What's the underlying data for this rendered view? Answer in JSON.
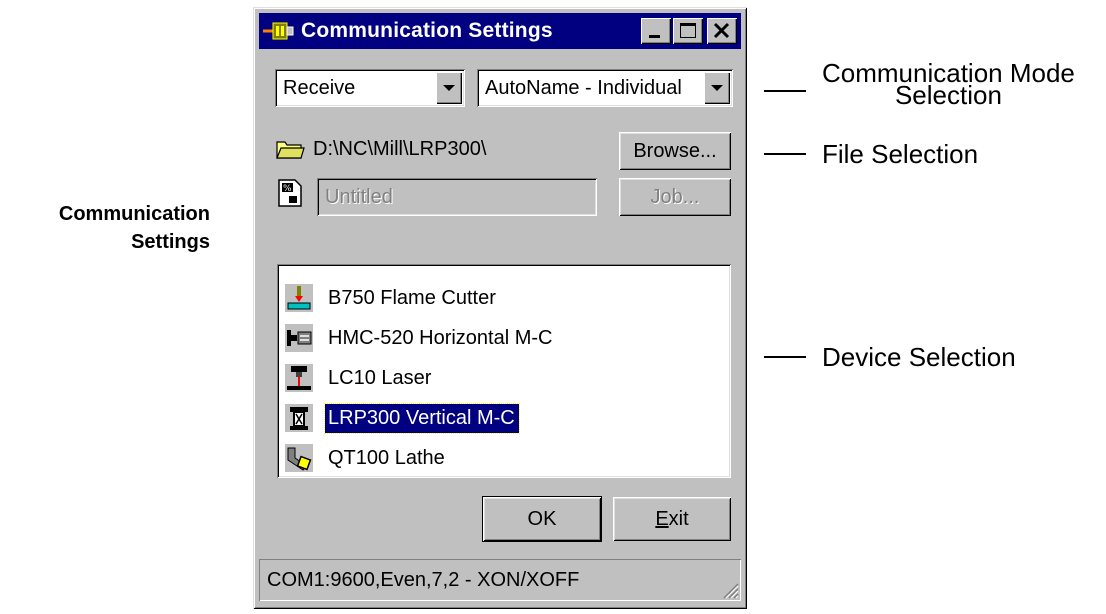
{
  "side_caption": {
    "line1": "Communication",
    "line2": "Settings"
  },
  "window": {
    "title": "Communication Settings",
    "mode_select": {
      "value": "Receive"
    },
    "naming_select": {
      "value": "AutoName - Individual"
    },
    "folder_path": "D:\\NC\\Mill\\LRP300\\",
    "browse_button": "Browse...",
    "job_field": {
      "value": "Untitled"
    },
    "job_button": "Job...",
    "devices": [
      {
        "label": "B750 Flame Cutter",
        "icon": "flame-cutter-icon",
        "selected": false
      },
      {
        "label": "HMC-520 Horizontal M-C",
        "icon": "horizontal-mill-icon",
        "selected": false
      },
      {
        "label": "LC10 Laser",
        "icon": "laser-icon",
        "selected": false
      },
      {
        "label": "LRP300 Vertical M-C",
        "icon": "vertical-mill-icon",
        "selected": true
      },
      {
        "label": "QT100 Lathe",
        "icon": "lathe-icon",
        "selected": false
      }
    ],
    "ok_button": "OK",
    "exit_button": {
      "mnemonic": "E",
      "rest": "xit"
    },
    "status_text": "COM1:9600,Even,7,2 - XON/XOFF"
  },
  "callouts": {
    "mode_line1": "Communication Mode",
    "mode_line2": "Selection",
    "file": "File Selection",
    "device": "Device Selection"
  },
  "colors": {
    "titlebar": "#000080",
    "face": "#c0c0c0",
    "selection": "#000080"
  }
}
